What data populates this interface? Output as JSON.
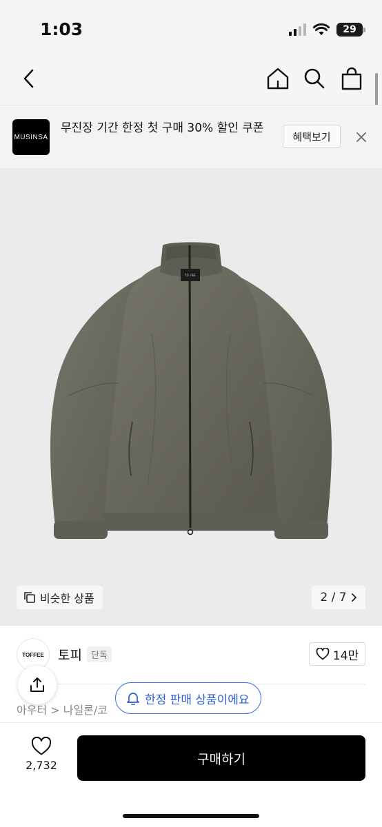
{
  "status_bar": {
    "time": "1:03",
    "battery": "29"
  },
  "nav": {
    "back_icon": "chevron-left-icon",
    "home_icon": "home-icon",
    "search_icon": "search-icon",
    "cart_icon": "shopping-bag-icon"
  },
  "promo": {
    "logo_text": "MUSINSA",
    "text": "무진장 기간 한정 첫 구매 30% 할인 쿠폰",
    "cta_label": "혜택보기",
    "close_icon": "close-icon"
  },
  "product_image": {
    "similar_label": "비슷한 상품",
    "pager_text": "2 / 7",
    "jacket_label_text": "TOFFEE",
    "background_color": "#ebebeb",
    "jacket_color": "#6b6a5e"
  },
  "brand": {
    "logo_text": "TOFFEE",
    "name": "토피",
    "badge": "단독",
    "likes": "14만"
  },
  "breadcrumb": "아우터 > 나일론/코",
  "toast": {
    "text": "한정 판매 상품이에요",
    "color": "#2d5fcf"
  },
  "bottom": {
    "wish_count": "2,732",
    "buy_label": "구매하기"
  }
}
